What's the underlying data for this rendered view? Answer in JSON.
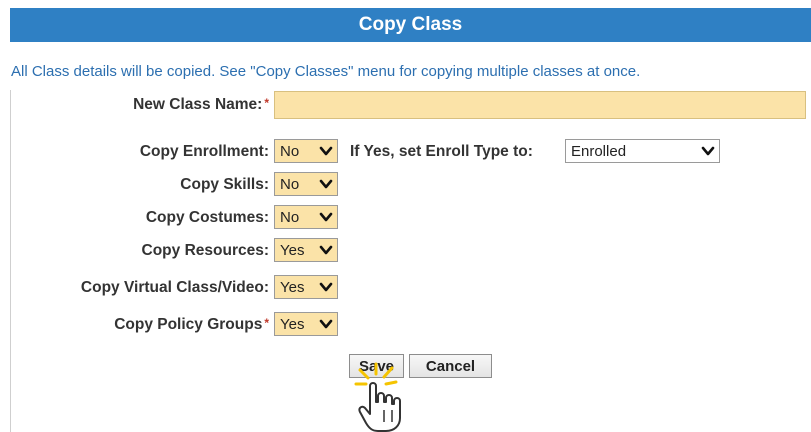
{
  "header": {
    "title": "Copy Class"
  },
  "note": "All Class details will be copied. See \"Copy Classes\" menu for copying multiple classes at once.",
  "fields": {
    "new_class_name": {
      "label": "New Class Name:",
      "required_mark": "*",
      "value": ""
    },
    "copy_enrollment": {
      "label": "Copy Enrollment:",
      "value": "No"
    },
    "enroll_type": {
      "label": "If Yes, set Enroll Type to:",
      "value": "Enrolled"
    },
    "copy_skills": {
      "label": "Copy Skills:",
      "value": "No"
    },
    "copy_costumes": {
      "label": "Copy Costumes:",
      "value": "No"
    },
    "copy_resources": {
      "label": "Copy Resources:",
      "value": "Yes"
    },
    "copy_virtual": {
      "label": "Copy Virtual Class/Video:",
      "value": "Yes"
    },
    "copy_policy": {
      "label": "Copy Policy Groups",
      "required_mark": "*",
      "value": "Yes"
    }
  },
  "buttons": {
    "save": "Save",
    "cancel": "Cancel"
  },
  "colors": {
    "header_bg": "#2f80c4",
    "note_text": "#2c6fb0",
    "field_highlight": "#fbe3a8",
    "required": "#c0392b"
  }
}
